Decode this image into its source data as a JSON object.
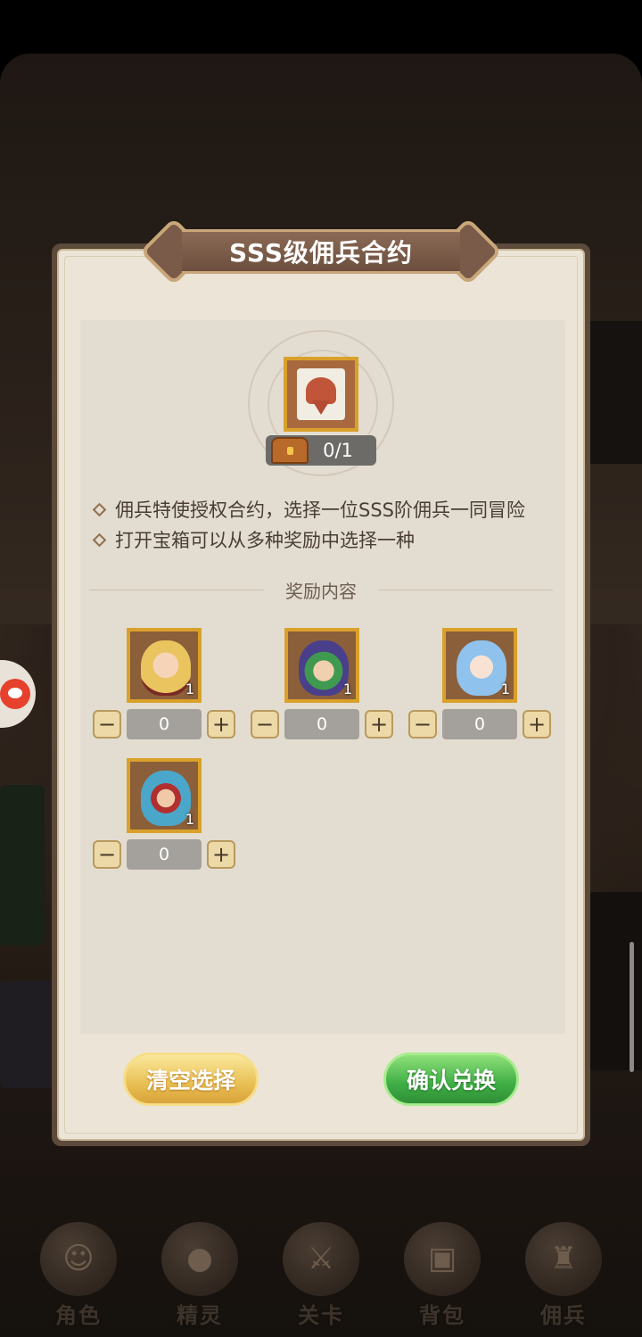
{
  "dialog": {
    "title": "SSS级佣兵合约",
    "contract_count": "0/1",
    "descriptions": [
      "佣兵特使授权合约，选择一位SSS阶佣兵一同冒险",
      "打开宝箱可以从多种奖励中选择一种"
    ],
    "rewards_header": "奖励内容",
    "rewards": [
      {
        "qty": "1",
        "value": "0",
        "minus": "−",
        "plus": "+"
      },
      {
        "qty": "1",
        "value": "0",
        "minus": "−",
        "plus": "+"
      },
      {
        "qty": "1",
        "value": "0",
        "minus": "−",
        "plus": "+"
      },
      {
        "qty": "1",
        "value": "0",
        "minus": "−",
        "plus": "+"
      }
    ],
    "clear_button": "清空选择",
    "confirm_button": "确认兑换"
  },
  "bottom_nav": [
    {
      "label": "角色",
      "icon": "character-icon"
    },
    {
      "label": "精灵",
      "icon": "spirit-icon"
    },
    {
      "label": "关卡",
      "icon": "stage-icon"
    },
    {
      "label": "背包",
      "icon": "backpack-icon"
    },
    {
      "label": "佣兵",
      "icon": "mercenary-icon"
    }
  ],
  "colors": {
    "frame_gold": "#d9a12a",
    "confirm_green": "#3fae45",
    "clear_yellow": "#e8bf54",
    "parchment": "#ece5d7"
  }
}
